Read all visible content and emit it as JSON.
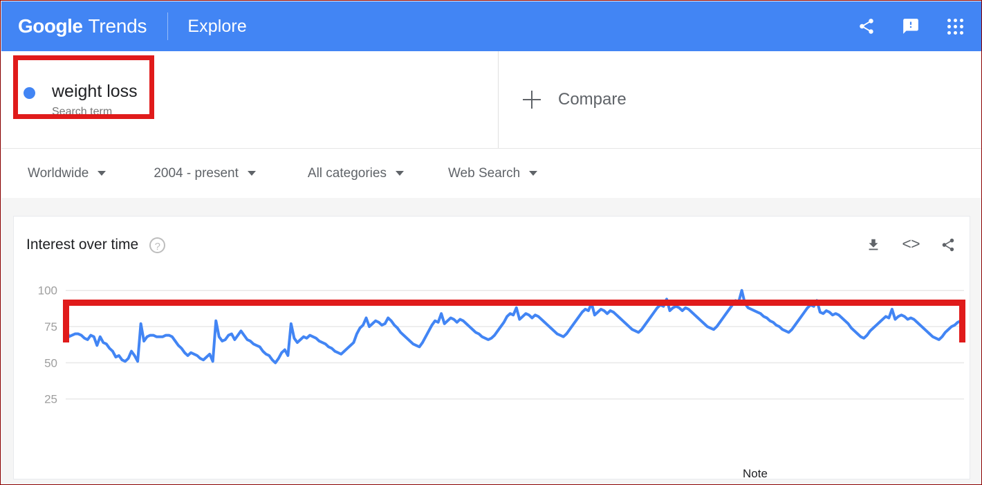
{
  "header": {
    "brand_primary": "Google",
    "brand_secondary": "Trends",
    "page_title": "Explore",
    "actions": [
      {
        "name": "share-icon",
        "label": "Share"
      },
      {
        "name": "feedback-icon",
        "label": "Send feedback"
      },
      {
        "name": "apps-grid-icon",
        "label": "Google apps"
      }
    ]
  },
  "terms": {
    "items": [
      {
        "title": "weight loss",
        "subtitle": "Search term",
        "color": "#4285f4"
      }
    ],
    "compare_label": "Compare"
  },
  "filters": [
    {
      "name": "location-filter",
      "label": "Worldwide"
    },
    {
      "name": "time-range-filter",
      "label": "2004 - present"
    },
    {
      "name": "category-filter",
      "label": "All categories"
    },
    {
      "name": "search-type-filter",
      "label": "Web Search"
    }
  ],
  "chart_card": {
    "title": "Interest over time",
    "help_label": "?",
    "actions": [
      {
        "name": "download-csv-icon",
        "label": "Download"
      },
      {
        "name": "embed-code-icon",
        "label": "<>"
      },
      {
        "name": "share-chart-icon",
        "label": "Share"
      }
    ],
    "note_label": "Note"
  },
  "annotations": {
    "color": "#e01b1b",
    "term_box_label": "highlight-search-term",
    "chart_bracket_label": "highlight-chart-top"
  },
  "chart_data": {
    "type": "line",
    "title": "Interest over time",
    "xlabel": "",
    "ylabel": "",
    "ylim": [
      0,
      108
    ],
    "yticks": [
      25,
      50,
      75,
      100
    ],
    "grid": true,
    "legend": false,
    "line_color": "#4285f4",
    "series": [
      {
        "name": "weight loss",
        "values": [
          75,
          68,
          69,
          70,
          70,
          69,
          67,
          66,
          69,
          68,
          62,
          68,
          64,
          63,
          60,
          58,
          54,
          55,
          52,
          51,
          53,
          58,
          55,
          51,
          77,
          65,
          68,
          69,
          69,
          68,
          68,
          68,
          69,
          69,
          68,
          65,
          62,
          60,
          57,
          55,
          57,
          56,
          55,
          53,
          52,
          54,
          56,
          51,
          79,
          68,
          65,
          66,
          69,
          70,
          66,
          69,
          72,
          69,
          66,
          65,
          63,
          62,
          61,
          58,
          56,
          55,
          52,
          50,
          53,
          57,
          59,
          55,
          77,
          67,
          64,
          66,
          68,
          67,
          69,
          68,
          67,
          65,
          64,
          63,
          61,
          60,
          58,
          57,
          56,
          58,
          60,
          62,
          64,
          70,
          74,
          76,
          81,
          75,
          77,
          79,
          78,
          76,
          77,
          81,
          79,
          76,
          74,
          71,
          69,
          67,
          65,
          63,
          62,
          61,
          64,
          68,
          72,
          76,
          79,
          78,
          84,
          77,
          79,
          81,
          80,
          78,
          80,
          79,
          77,
          75,
          73,
          71,
          70,
          68,
          67,
          66,
          67,
          69,
          72,
          75,
          78,
          82,
          84,
          83,
          88,
          80,
          82,
          84,
          83,
          81,
          83,
          82,
          80,
          78,
          76,
          74,
          72,
          70,
          69,
          68,
          70,
          73,
          76,
          79,
          82,
          85,
          87,
          86,
          91,
          83,
          85,
          87,
          86,
          84,
          86,
          85,
          83,
          81,
          79,
          77,
          75,
          73,
          72,
          71,
          73,
          76,
          79,
          82,
          85,
          88,
          90,
          89,
          94,
          86,
          88,
          89,
          88,
          86,
          88,
          87,
          85,
          83,
          81,
          79,
          77,
          75,
          74,
          73,
          75,
          78,
          81,
          84,
          87,
          90,
          93,
          92,
          100,
          91,
          88,
          87,
          86,
          85,
          84,
          82,
          81,
          79,
          78,
          76,
          75,
          73,
          72,
          71,
          73,
          76,
          79,
          82,
          85,
          88,
          90,
          89,
          93,
          85,
          84,
          86,
          85,
          83,
          84,
          83,
          81,
          79,
          77,
          74,
          72,
          70,
          68,
          67,
          69,
          72,
          74,
          76,
          78,
          80,
          82,
          81,
          87,
          80,
          82,
          83,
          82,
          80,
          81,
          80,
          78,
          76,
          74,
          72,
          70,
          68,
          67,
          66,
          68,
          71,
          73,
          75,
          76,
          78,
          79,
          78
        ]
      }
    ]
  }
}
